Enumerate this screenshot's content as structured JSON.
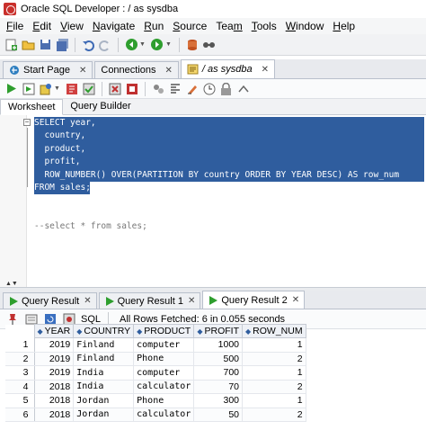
{
  "window": {
    "title": "Oracle SQL Developer : / as sysdba"
  },
  "menu": [
    {
      "label": "File",
      "key": "F"
    },
    {
      "label": "Edit",
      "key": "E"
    },
    {
      "label": "View",
      "key": "V"
    },
    {
      "label": "Navigate",
      "key": "N"
    },
    {
      "label": "Run",
      "key": "R"
    },
    {
      "label": "Source",
      "key": "S"
    },
    {
      "label": "Team",
      "key": "m"
    },
    {
      "label": "Tools",
      "key": "T"
    },
    {
      "label": "Window",
      "key": "W"
    },
    {
      "label": "Help",
      "key": "H"
    }
  ],
  "doc_tabs": [
    {
      "label": "Start Page"
    },
    {
      "label": "Connections"
    },
    {
      "label": "/ as sysdba"
    }
  ],
  "sub_tabs": {
    "worksheet": "Worksheet",
    "query_builder": "Query Builder"
  },
  "editor": {
    "lines": [
      "SELECT year,",
      "  country,",
      "  product,",
      "  profit,",
      "  ROW_NUMBER() OVER(PARTITION BY country ORDER BY YEAR DESC) AS row_num",
      "FROM sales;",
      "",
      "",
      "--select * from sales;"
    ]
  },
  "result_tabs": [
    {
      "label": "Query Result"
    },
    {
      "label": "Query Result 1"
    },
    {
      "label": "Query Result 2"
    }
  ],
  "result_toolbar": {
    "sql_label": "SQL",
    "status": "All Rows Fetched: 6 in 0.055 seconds"
  },
  "grid": {
    "columns": [
      "YEAR",
      "COUNTRY",
      "PRODUCT",
      "PROFIT",
      "ROW_NUM"
    ],
    "rows": [
      {
        "n": "1",
        "year": "2019",
        "country": "Finland",
        "product": "computer",
        "profit": "1000",
        "row_num": "1"
      },
      {
        "n": "2",
        "year": "2019",
        "country": "Finland",
        "product": "Phone",
        "profit": "500",
        "row_num": "2"
      },
      {
        "n": "3",
        "year": "2019",
        "country": "India",
        "product": "computer",
        "profit": "700",
        "row_num": "1"
      },
      {
        "n": "4",
        "year": "2018",
        "country": "India",
        "product": "calculator",
        "profit": "70",
        "row_num": "2"
      },
      {
        "n": "5",
        "year": "2018",
        "country": "Jordan",
        "product": "Phone",
        "profit": "300",
        "row_num": "1"
      },
      {
        "n": "6",
        "year": "2018",
        "country": "Jordan",
        "product": "calculator",
        "profit": "50",
        "row_num": "2"
      }
    ]
  },
  "colors": {
    "selection": "#2f5d9e",
    "run_green": "#2e9e2e",
    "comment": "#777777"
  }
}
